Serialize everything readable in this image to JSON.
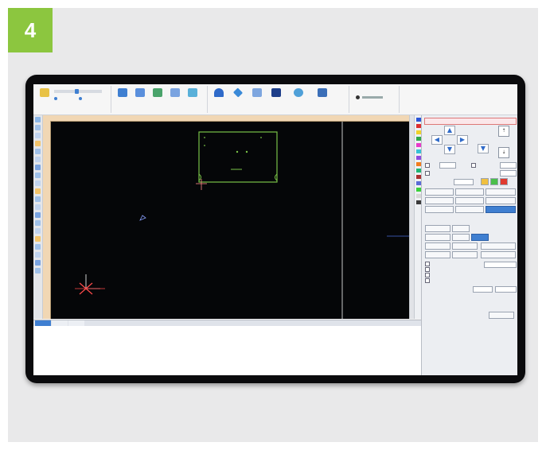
{
  "step": {
    "number": "4",
    "color": "#8cc63f"
  },
  "app": {
    "ribbon": {
      "groups": [
        {
          "caption": "",
          "items": []
        },
        {
          "caption": "",
          "items": []
        },
        {
          "caption": "",
          "items": []
        },
        {
          "caption": "",
          "items": []
        }
      ]
    },
    "canvas": {
      "message": "",
      "background": "#050608",
      "part_outline_color": "#79c247",
      "cursor_color": "#ff4a4a"
    },
    "log": {
      "tabs": [
        "",
        "",
        ""
      ],
      "lines": [
        "",
        "",
        "",
        "",
        "",
        ""
      ]
    },
    "right_panel": {
      "header": "",
      "step_values": [
        "",
        ""
      ],
      "accent": "#3f7fd1"
    },
    "colors": [
      "#2a55d8",
      "#dd2e2e",
      "#f0d22a",
      "#2ea84a",
      "#e83ac9",
      "#35c2d6",
      "#8d4be0",
      "#f27c1d",
      "#1fb573",
      "#aa3030",
      "#5a6bd6",
      "#39d13a",
      "#d6d6d6",
      "#3b3b3b"
    ]
  }
}
